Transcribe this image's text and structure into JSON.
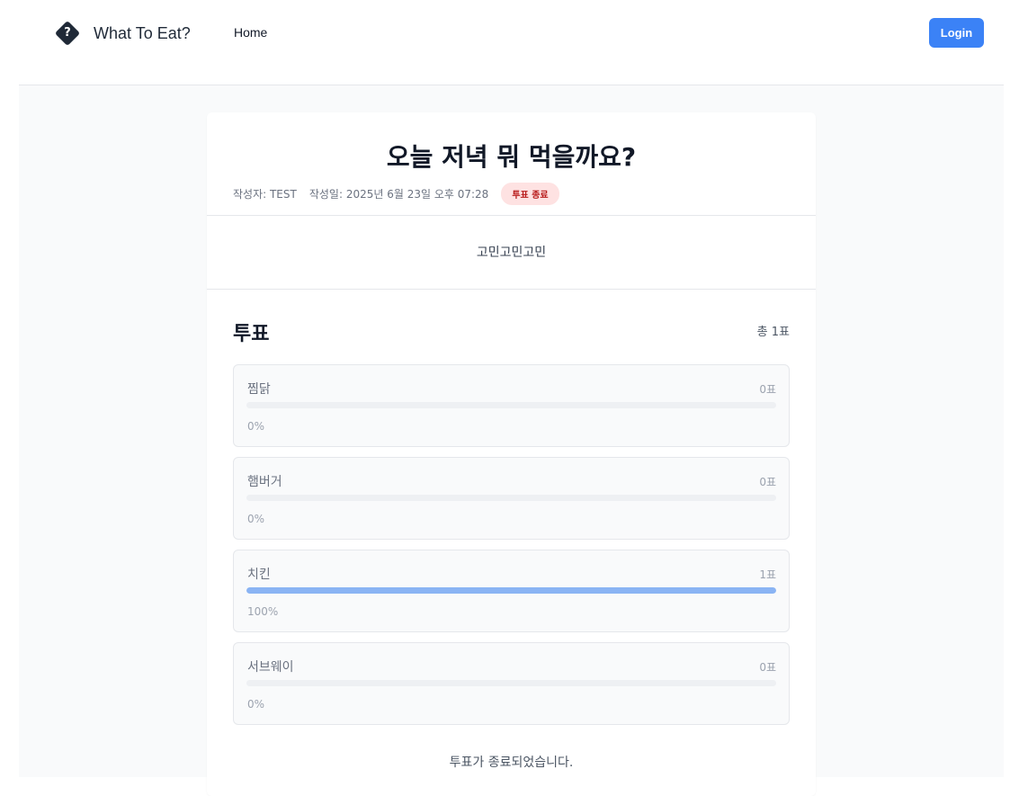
{
  "header": {
    "logo_icon": "question-diamond-icon",
    "logo_glyph": "?",
    "brand": "What To Eat?",
    "nav": {
      "home": "Home"
    },
    "login_label": "Login",
    "login_color": "#3b82f6"
  },
  "post": {
    "title": "오늘 저녁 뭐 먹을까요?",
    "author": "작성자: TEST",
    "date": "작성일: 2025년 6월 23일 오후 07:28",
    "status_badge": "투표 종료",
    "content": "고민고민고민"
  },
  "vote": {
    "title": "투표",
    "total": "총 1표",
    "bar_color": "#8ab4f4",
    "options": [
      {
        "name": "찜닭",
        "count": "0표",
        "percent_label": "0%",
        "fraction": 0
      },
      {
        "name": "햄버거",
        "count": "0표",
        "percent_label": "0%",
        "fraction": 0
      },
      {
        "name": "치킨",
        "count": "1표",
        "percent_label": "100%",
        "fraction": 1
      },
      {
        "name": "서브웨이",
        "count": "0표",
        "percent_label": "0%",
        "fraction": 0
      }
    ],
    "ended_message": "투표가 종료되었습니다."
  }
}
